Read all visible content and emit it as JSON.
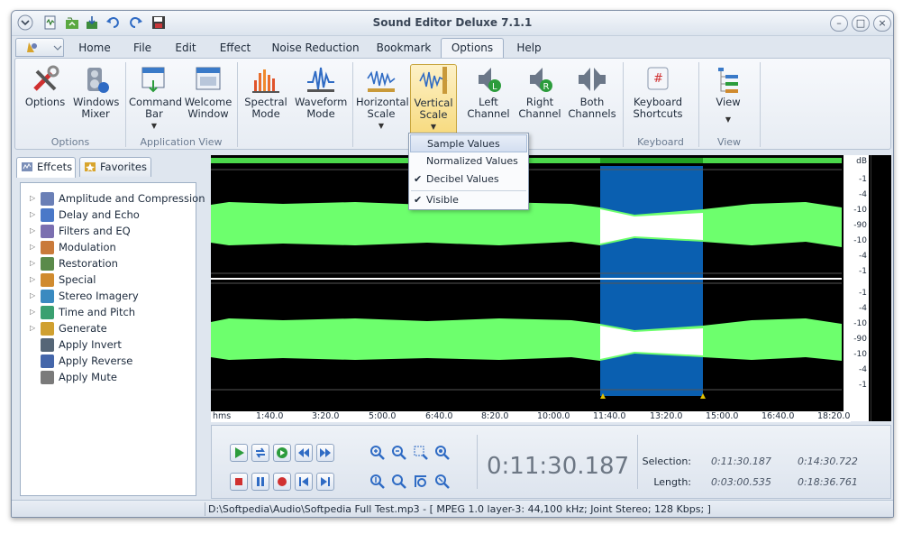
{
  "app": {
    "title": "Sound Editor Deluxe 7.1.1"
  },
  "menu": [
    "Home",
    "File",
    "Edit",
    "Effect",
    "Noise Reduction",
    "Bookmark",
    "Options",
    "Help"
  ],
  "menu_active": "Options",
  "ribbon": {
    "options_group": {
      "label": "Options",
      "options": "Options",
      "mixer_1": "Windows",
      "mixer_2": "Mixer"
    },
    "appview_group": {
      "label": "Application View",
      "cmd_1": "Command",
      "cmd_2": "Bar",
      "welcome_1": "Welcome",
      "welcome_2": "Window"
    },
    "mode_group": {
      "spectral_1": "Spectral",
      "spectral_2": "Mode",
      "waveform_1": "Waveform",
      "waveform_2": "Mode"
    },
    "scale_group": {
      "hscale_1": "Horizontal",
      "hscale_2": "Scale",
      "vscale_1": "Vertical",
      "vscale_2": "Scale",
      "left_1": "Left",
      "left_2": "Channel",
      "right_1": "Right",
      "right_2": "Channel",
      "both_1": "Both",
      "both_2": "Channels"
    },
    "keyboard_group": {
      "label": "Keyboard",
      "kb_1": "Keyboard",
      "kb_2": "Shortcuts"
    },
    "view_group": {
      "label": "View",
      "view": "View"
    }
  },
  "vertical_scale_menu": {
    "items": [
      {
        "label": "Sample Values",
        "checked": false,
        "highlighted": true
      },
      {
        "label": "Normalized Values",
        "checked": false
      },
      {
        "label": "Decibel Values",
        "checked": true
      },
      {
        "label": "Visible",
        "checked": true
      }
    ]
  },
  "left_panel": {
    "tabs": [
      "Effcets",
      "Favorites"
    ],
    "effects": [
      {
        "label": "Amplitude and Compression",
        "icon": "amplitude-icon",
        "color": "#6a7fb6"
      },
      {
        "label": "Delay and Echo",
        "icon": "delay-icon",
        "color": "#4a78c8"
      },
      {
        "label": "Filters and EQ",
        "icon": "filters-icon",
        "color": "#7b6fb0"
      },
      {
        "label": "Modulation",
        "icon": "modulation-icon",
        "color": "#c97a3a"
      },
      {
        "label": "Restoration",
        "icon": "restoration-icon",
        "color": "#5a8a4a"
      },
      {
        "label": "Special",
        "icon": "special-icon",
        "color": "#d08b2f"
      },
      {
        "label": "Stereo Imagery",
        "icon": "stereo-icon",
        "color": "#3a8ac0"
      },
      {
        "label": "Time and Pitch",
        "icon": "time-pitch-icon",
        "color": "#3aa070"
      },
      {
        "label": "Generate",
        "icon": "generate-icon",
        "color": "#d0a030"
      },
      {
        "label": "Apply Invert",
        "icon": "invert-icon",
        "color": "#556677"
      },
      {
        "label": "Apply Reverse",
        "icon": "reverse-icon",
        "color": "#4466aa"
      },
      {
        "label": "Apply Mute",
        "icon": "mute-icon",
        "color": "#7a7a7a"
      }
    ]
  },
  "waveform": {
    "timeline": [
      "hms",
      "1:40.0",
      "3:20.0",
      "5:00.0",
      "6:40.0",
      "8:20.0",
      "10:00.0",
      "11:40.0",
      "13:20.0",
      "15:00.0",
      "16:40.0",
      "18:20.0"
    ],
    "db_header": "dB",
    "db_scale": [
      "-1",
      "-4",
      "-10",
      "-90",
      "-10",
      "-4",
      "-1"
    ],
    "wave_color": "#6dff6d",
    "selection_color": "#0a5fb0"
  },
  "transport": {
    "time": "0:11:30.187",
    "selection_label": "Selection:",
    "length_label": "Length:",
    "selection_start": "0:11:30.187",
    "selection_end": "0:14:30.722",
    "length_selection": "0:03:00.535",
    "length_total": "0:18:36.761"
  },
  "status": {
    "text": "D:\\Softpedia\\Audio\\Softpedia Full Test.mp3 - [ MPEG 1.0 layer-3: 44,100 kHz; Joint Stereo; 128 Kbps; ]"
  }
}
